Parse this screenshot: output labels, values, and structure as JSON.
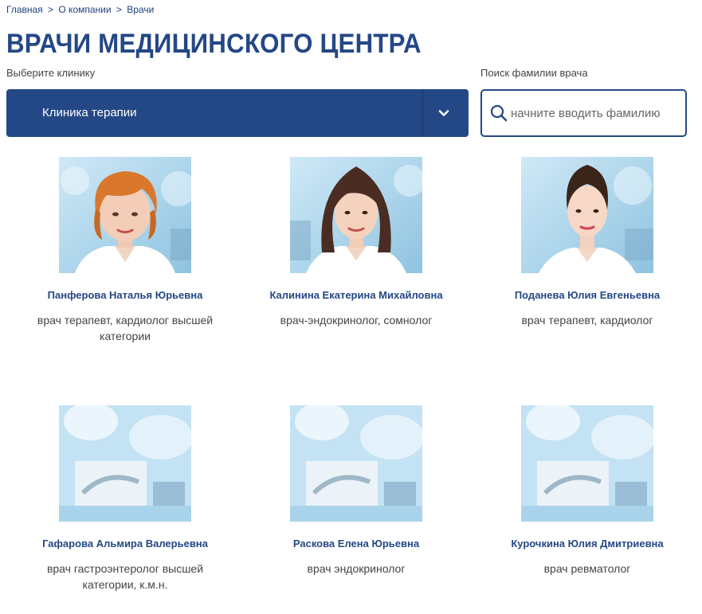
{
  "breadcrumb": {
    "items": [
      "Главная",
      "О компании"
    ],
    "separator": ">",
    "current": "Врачи"
  },
  "page_title": "ВРАЧИ МЕДИЦИНСКОГО ЦЕНТРА",
  "filters": {
    "clinic_label": "Выберите клинику",
    "clinic_selected": "Клиника терапии",
    "search_label": "Поиск фамилии врача",
    "search_placeholder": "начните вводить фамилию",
    "search_value": ""
  },
  "doctors": [
    {
      "name": "Панферова Наталья Юрьевна",
      "role": "врач терапевт, кардиолог высшей категории",
      "photo": "portrait-redhead"
    },
    {
      "name": "Калинина Екатерина Михайловна",
      "role": "врач-эндокринолог, сомнолог",
      "photo": "portrait-brunette"
    },
    {
      "name": "Поданева Юлия Евгеньевна",
      "role": "врач терапевт, кардиолог",
      "photo": "portrait-updo"
    },
    {
      "name": "Гафарова Альмира Валерьевна",
      "role": "врач гастроэнтеролог высшей категории, к.м.н.",
      "photo": "placeholder-operating-room"
    },
    {
      "name": "Раскова Елена Юрьевна",
      "role": "врач эндокринолог",
      "photo": "placeholder-operating-room"
    },
    {
      "name": "Курочкина Юлия Дмитриевна",
      "role": "врач ревматолог",
      "photo": "placeholder-operating-room"
    }
  ],
  "colors": {
    "brand": "#244886",
    "photo_bg": "#bfe0f2"
  },
  "icons": {
    "select_arrow": "chevron-down-icon",
    "search": "search-icon"
  }
}
